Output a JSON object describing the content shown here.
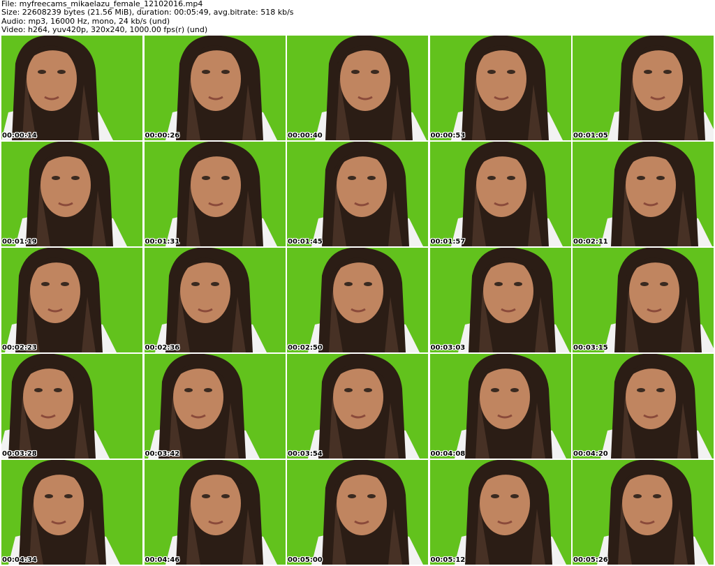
{
  "header": {
    "file_line": "File: myfreecams_mikaelazu_female_12102016.mp4",
    "size_line": "Size: 22608239 bytes (21.56 MiB), duration: 00:05:49, avg.bitrate: 518 kb/s",
    "audio_line": "Audio: mp3, 16000 Hz, mono, 24 kb/s (und)",
    "video_line": "Video: h264, yuv420p, 320x240, 1000.00 fps(r) (und)"
  },
  "colors": {
    "background_green": "#62c21d",
    "hair_dark": "#2b1d15",
    "hair_light": "#5a4030",
    "skin": "#c08560",
    "shirt": "#f2f2f2"
  },
  "frames": [
    {
      "timestamp": "00:00:14"
    },
    {
      "timestamp": "00:00:26"
    },
    {
      "timestamp": "00:00:40"
    },
    {
      "timestamp": "00:00:53"
    },
    {
      "timestamp": "00:01:05"
    },
    {
      "timestamp": "00:01:19"
    },
    {
      "timestamp": "00:01:31"
    },
    {
      "timestamp": "00:01:45"
    },
    {
      "timestamp": "00:01:57"
    },
    {
      "timestamp": "00:02:11"
    },
    {
      "timestamp": "00:02:23"
    },
    {
      "timestamp": "00:02:36"
    },
    {
      "timestamp": "00:02:50"
    },
    {
      "timestamp": "00:03:03"
    },
    {
      "timestamp": "00:03:15"
    },
    {
      "timestamp": "00:03:28"
    },
    {
      "timestamp": "00:03:42"
    },
    {
      "timestamp": "00:03:54"
    },
    {
      "timestamp": "00:04:08"
    },
    {
      "timestamp": "00:04:20"
    },
    {
      "timestamp": "00:04:34"
    },
    {
      "timestamp": "00:04:46"
    },
    {
      "timestamp": "00:05:00"
    },
    {
      "timestamp": "00:05:12"
    },
    {
      "timestamp": "00:05:26"
    }
  ]
}
